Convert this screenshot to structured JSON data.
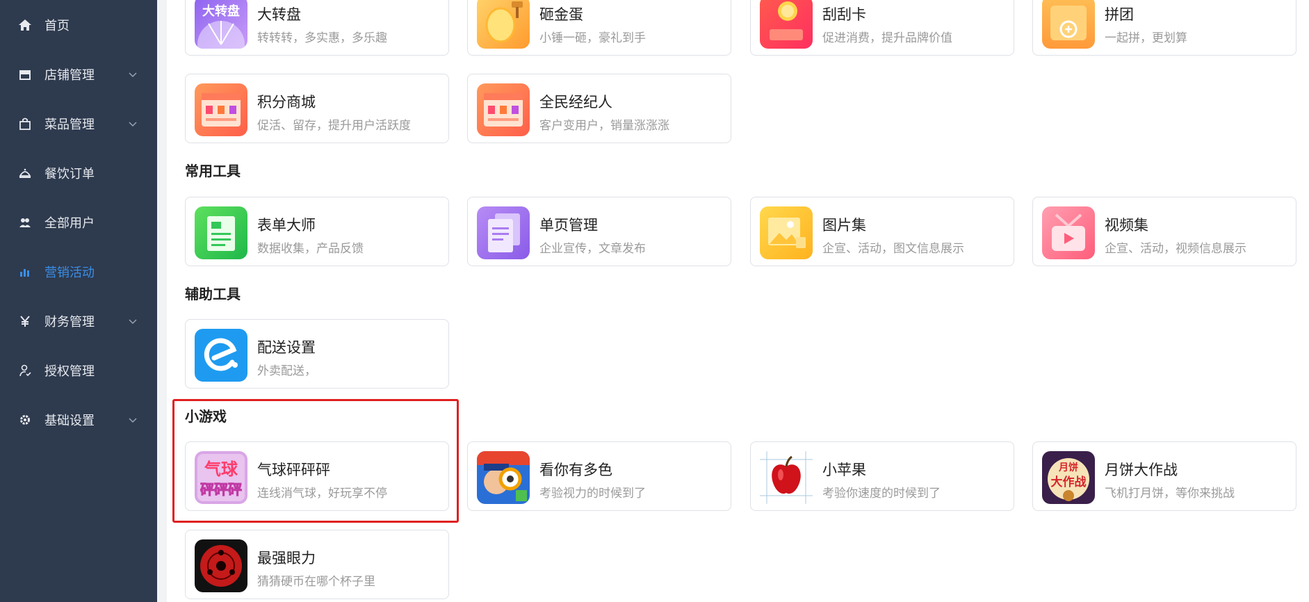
{
  "sidebar": {
    "items": [
      {
        "label": "首页",
        "icon": "home-icon",
        "has_chevron": false,
        "active": false
      },
      {
        "label": "店铺管理",
        "icon": "store-icon",
        "has_chevron": true,
        "active": false
      },
      {
        "label": "菜品管理",
        "icon": "bag-icon",
        "has_chevron": true,
        "active": false
      },
      {
        "label": "餐饮订单",
        "icon": "dish-cover-icon",
        "has_chevron": false,
        "active": false
      },
      {
        "label": "全部用户",
        "icon": "users-icon",
        "has_chevron": false,
        "active": false
      },
      {
        "label": "营销活动",
        "icon": "chart-icon",
        "has_chevron": false,
        "active": true
      },
      {
        "label": "财务管理",
        "icon": "yen-icon",
        "has_chevron": true,
        "active": false
      },
      {
        "label": "授权管理",
        "icon": "user-auth-icon",
        "has_chevron": false,
        "active": false
      },
      {
        "label": "基础设置",
        "icon": "gear-icon",
        "has_chevron": true,
        "active": false
      }
    ],
    "colors": {
      "bg": "#2e3a4e",
      "text": "#e6e9ee",
      "active": "#3a8ee6"
    }
  },
  "marketing": {
    "items": [
      {
        "title": "大转盘",
        "desc": "转转转，多实惠，多乐趣",
        "icon": "wheel-icon"
      },
      {
        "title": "砸金蛋",
        "desc": "小锤一砸，豪礼到手",
        "icon": "golden-egg-icon"
      },
      {
        "title": "刮刮卡",
        "desc": "促进消费，提升品牌价值",
        "icon": "scratch-card-icon"
      },
      {
        "title": "拼团",
        "desc": "一起拼，更划算",
        "icon": "group-buy-icon"
      },
      {
        "title": "积分商城",
        "desc": "促活、留存，提升用户活跃度",
        "icon": "points-mall-icon"
      },
      {
        "title": "全民经纪人",
        "desc": "客户变用户，销量涨涨涨",
        "icon": "broker-icon"
      }
    ]
  },
  "common_tools": {
    "title": "常用工具",
    "items": [
      {
        "title": "表单大师",
        "desc": "数据收集，产品反馈",
        "icon": "form-icon"
      },
      {
        "title": "单页管理",
        "desc": "企业宣传，文章发布",
        "icon": "page-icon"
      },
      {
        "title": "图片集",
        "desc": "企宣、活动，图文信息展示",
        "icon": "gallery-icon"
      },
      {
        "title": "视频集",
        "desc": "企宣、活动，视频信息展示",
        "icon": "video-icon"
      }
    ]
  },
  "aux_tools": {
    "title": "辅助工具",
    "items": [
      {
        "title": "配送设置",
        "desc": "外卖配送，",
        "icon": "delivery-icon"
      }
    ]
  },
  "mini_games": {
    "title": "小游戏",
    "items": [
      {
        "title": "气球砰砰砰",
        "desc": "连线消气球，好玩享不停",
        "icon": "balloon-game-icon"
      },
      {
        "title": "看你有多色",
        "desc": "考验视力的时候到了",
        "icon": "color-game-icon"
      },
      {
        "title": "小苹果",
        "desc": "考验你速度的时候到了",
        "icon": "apple-icon"
      },
      {
        "title": "月饼大作战",
        "desc": "飞机打月饼，等你来挑战",
        "icon": "mooncake-icon"
      },
      {
        "title": "最强眼力",
        "desc": "猜猜硬币在哪个杯子里",
        "icon": "eye-icon"
      }
    ]
  },
  "icon_text": {
    "wheel": "大转盘",
    "balloon_top": "气球",
    "balloon_bottom": "砰砰砰",
    "mooncake_top": "月饼",
    "mooncake_bottom": "大作战"
  }
}
